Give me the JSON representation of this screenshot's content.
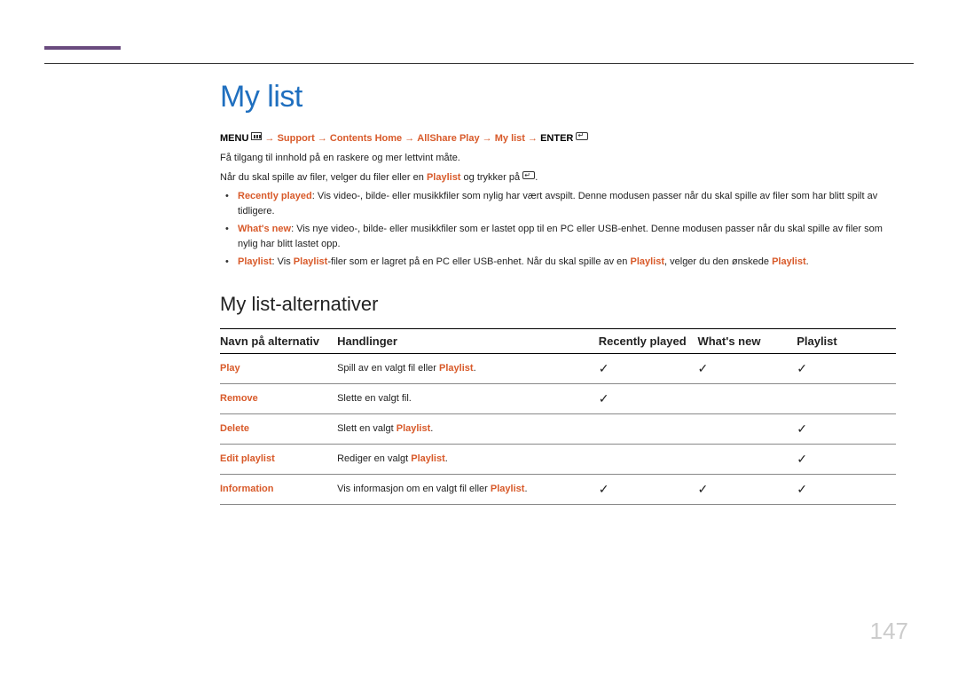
{
  "page_number": "147",
  "title": "My list",
  "breadcrumb": {
    "menu": "MENU",
    "arrow": "→",
    "p1": "Support",
    "p2": "Contents Home",
    "p3": "AllShare Play",
    "p4": "My list",
    "enter": "ENTER"
  },
  "intro": {
    "l1": "Få tilgang til innhold på en raskere og mer lettvint måte.",
    "l2a": "Når du skal spille av filer, velger du filer eller en ",
    "l2b": "Playlist",
    "l2c": " og trykker på "
  },
  "bullets": [
    {
      "t": "Recently played",
      "rest": ": Vis video-, bilde- eller musikkfiler som nylig har vært avspilt. Denne modusen passer når du skal spille av filer som har blitt spilt av tidligere."
    },
    {
      "t": "What's new",
      "rest": ": Vis nye video-, bilde- eller musikkfiler som er lastet opp til en PC eller USB-enhet. Denne modusen passer når du skal spille av filer som nylig har blitt lastet opp."
    },
    {
      "t": "Playlist",
      "rest_a": ": Vis ",
      "k1": "Playlist",
      "rest_b": "-filer som er lagret på en PC eller USB-enhet. Når du skal spille av en ",
      "k2": "Playlist",
      "rest_c": ", velger du den ønskede ",
      "k3": "Playlist",
      "rest_d": "."
    }
  ],
  "subhead": "My list-alternativer",
  "table": {
    "headers": {
      "c0": "Navn på alternativ",
      "c1": "Handlinger",
      "c2": "Recently played",
      "c3": "What's new",
      "c4": "Playlist"
    },
    "rows": [
      {
        "name": "Play",
        "act_a": "Spill av en valgt fil eller ",
        "k": "Playlist",
        "act_b": ".",
        "c2": "✓",
        "c3": "✓",
        "c4": "✓"
      },
      {
        "name": "Remove",
        "act_a": "Slette en valgt fil.",
        "k": "",
        "act_b": "",
        "c2": "✓",
        "c3": "",
        "c4": ""
      },
      {
        "name": "Delete",
        "act_a": "Slett en valgt ",
        "k": "Playlist",
        "act_b": ".",
        "c2": "",
        "c3": "",
        "c4": "✓"
      },
      {
        "name": "Edit playlist",
        "act_a": "Rediger en valgt ",
        "k": "Playlist",
        "act_b": ".",
        "c2": "",
        "c3": "",
        "c4": "✓"
      },
      {
        "name": "Information",
        "act_a": "Vis informasjon om en valgt fil eller ",
        "k": "Playlist",
        "act_b": ".",
        "c2": "✓",
        "c3": "✓",
        "c4": "✓"
      }
    ]
  }
}
